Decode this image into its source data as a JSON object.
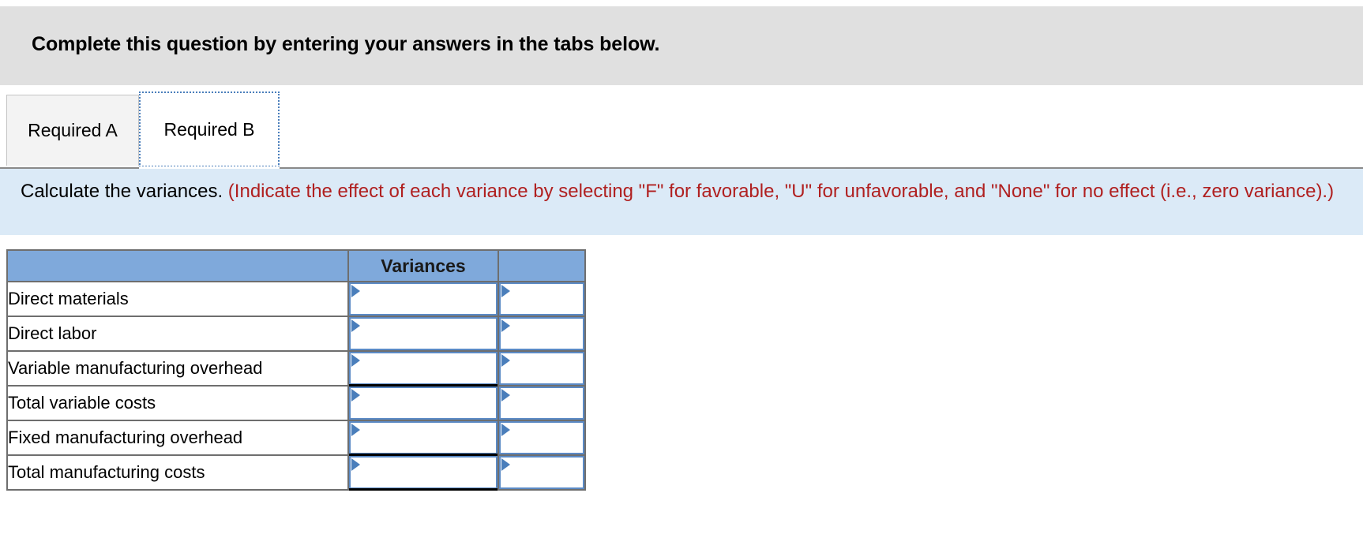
{
  "banner": {
    "title": "Complete this question by entering your answers in the tabs below."
  },
  "tabs": [
    {
      "label": "Required A",
      "active": false
    },
    {
      "label": "Required B",
      "active": true
    }
  ],
  "instruction": {
    "bold_part": "Calculate the variances.",
    "red_part": " (Indicate the effect of each variance by selecting \"F\" for favorable, \"U\" for unfavorable, and \"None\" for no effect (i.e., zero variance).)"
  },
  "table": {
    "headers": [
      "",
      "Variances",
      ""
    ],
    "rows": [
      {
        "label": "Direct materials",
        "variance": "",
        "effect": "",
        "subtotal_rule": false
      },
      {
        "label": "Direct labor",
        "variance": "",
        "effect": "",
        "subtotal_rule": false
      },
      {
        "label": "Variable manufacturing overhead",
        "variance": "",
        "effect": "",
        "subtotal_rule": true
      },
      {
        "label": "Total variable costs",
        "variance": "",
        "effect": "",
        "subtotal_rule": false
      },
      {
        "label": "Fixed manufacturing overhead",
        "variance": "",
        "effect": "",
        "subtotal_rule": true
      },
      {
        "label": "Total manufacturing costs",
        "variance": "",
        "effect": "",
        "subtotal_rule": true
      }
    ]
  },
  "colors": {
    "banner_gray": "#e0e0e0",
    "instruction_blue": "#dbeaf7",
    "header_blue": "#7fa9db",
    "input_border_blue": "#5b8ac5",
    "red_text": "#b02020",
    "focus_blue": "#4a7ebb"
  }
}
